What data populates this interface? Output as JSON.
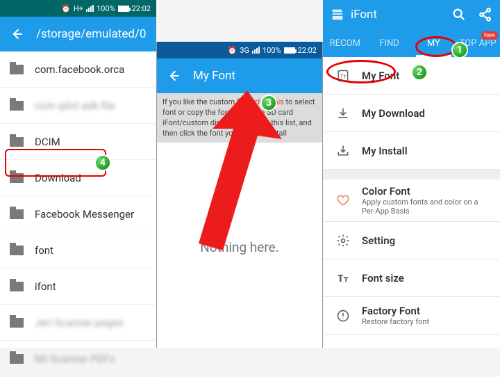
{
  "status": {
    "nettype": "3G",
    "h": "H+",
    "battery_pct": "100%",
    "time": "22:02"
  },
  "col1": {
    "path": "/storage/emulated/0",
    "items": [
      {
        "label": "com.facebook.orca",
        "blur": false
      },
      {
        "label": "com qdot adk file",
        "blur": true
      },
      {
        "label": "DCIM",
        "blur": false
      },
      {
        "label": "Download",
        "blur": false,
        "highlight": true
      },
      {
        "label": "Facebook Messenger",
        "blur": false
      },
      {
        "label": "font",
        "blur": false
      },
      {
        "label": "ifont",
        "blur": false
      },
      {
        "label": "Jeri Scanner pages",
        "blur": true
      },
      {
        "label": "Mt Scanner PDFs",
        "blur": true
      }
    ]
  },
  "col2": {
    "title": "My Font",
    "info_pre": "If you like the custom font, ",
    "info_link": "click this",
    "info_post": " to select font or copy the font file to the SD card iFont/custom directory, re-enter this list, and then click the font you want to install",
    "empty": "Nothing here."
  },
  "col3": {
    "app_title": "iFont",
    "tabs": [
      "RECOM",
      "FIND",
      "MY",
      "TOP APP"
    ],
    "tab_new": "New",
    "menu": [
      {
        "icon": "font-file",
        "title": "My Font",
        "highlight": true
      },
      {
        "icon": "download",
        "title": "My Download"
      },
      {
        "icon": "install",
        "title": "My Install"
      },
      {
        "gap": true
      },
      {
        "icon": "heart",
        "title": "Color Font",
        "sub": "Apply custom fonts and color on a Per-App Basis"
      },
      {
        "icon": "gear",
        "title": "Setting"
      },
      {
        "icon": "textsize",
        "title": "Font size"
      },
      {
        "icon": "alert",
        "title": "Factory Font",
        "sub": "Restore factory font"
      }
    ]
  },
  "badges": {
    "b1": "1",
    "b2": "2",
    "b3": "3",
    "b4": "4"
  }
}
